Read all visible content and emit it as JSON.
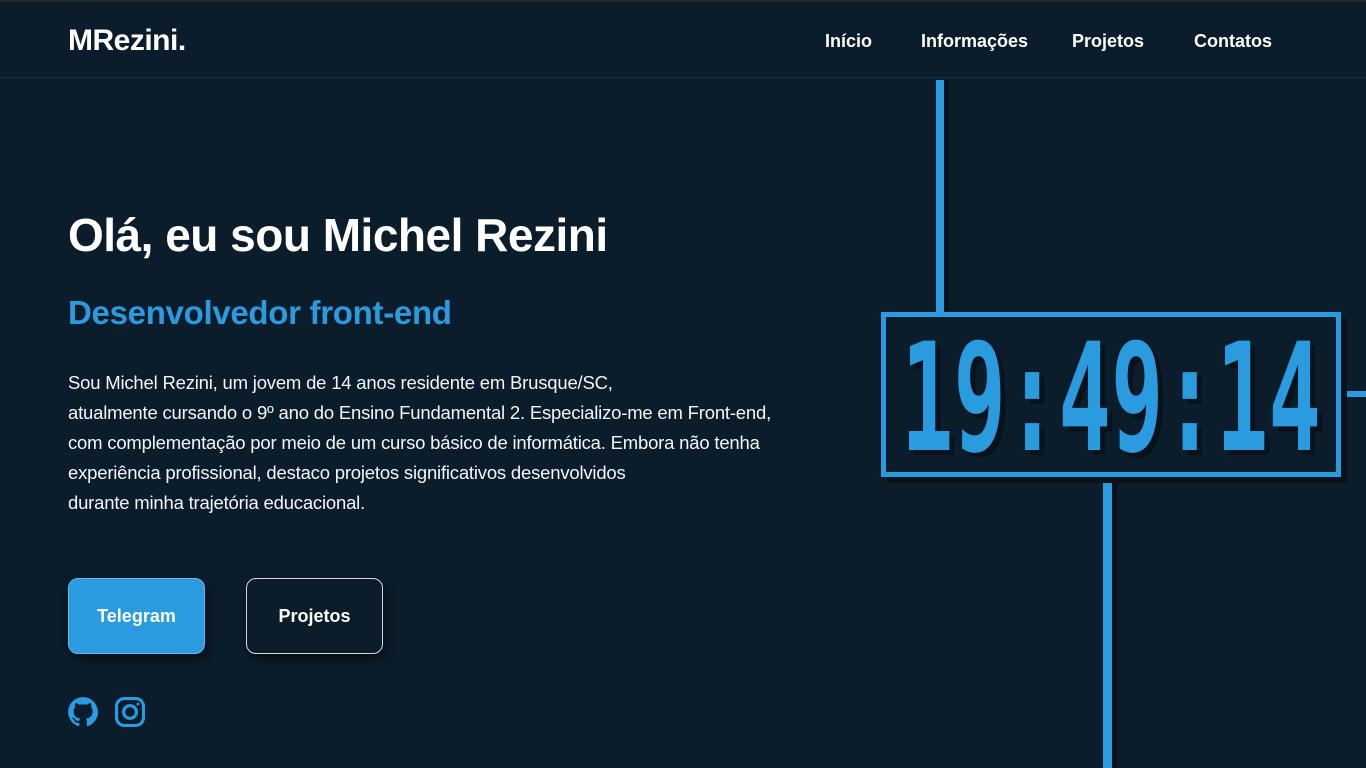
{
  "header": {
    "logo": "MRezini.",
    "nav": [
      {
        "label": "Início"
      },
      {
        "label": "Informações"
      },
      {
        "label": "Projetos"
      },
      {
        "label": "Contatos"
      }
    ]
  },
  "hero": {
    "title": "Olá, eu sou Michel Rezini",
    "subtitle": "Desenvolvedor front-end",
    "bio_lines": [
      "Sou Michel Rezini, um jovem de 14 anos residente em Brusque/SC,",
      "atualmente cursando o 9º ano do Ensino Fundamental 2. Especializo-me em Front-end,",
      "com complementação por meio de um curso básico de informática. Embora não tenha",
      "experiência profissional, destaco projetos significativos desenvolvidos",
      "durante minha trajetória educacional."
    ],
    "buttons": {
      "telegram": "Telegram",
      "projetos": "Projetos"
    },
    "social": [
      {
        "icon": "github-icon"
      },
      {
        "icon": "instagram-icon"
      }
    ]
  },
  "clock": {
    "time": "19:49:14"
  },
  "colors": {
    "background": "#0b1c2b",
    "accent": "#2b9be0",
    "text": "#ffffff"
  }
}
